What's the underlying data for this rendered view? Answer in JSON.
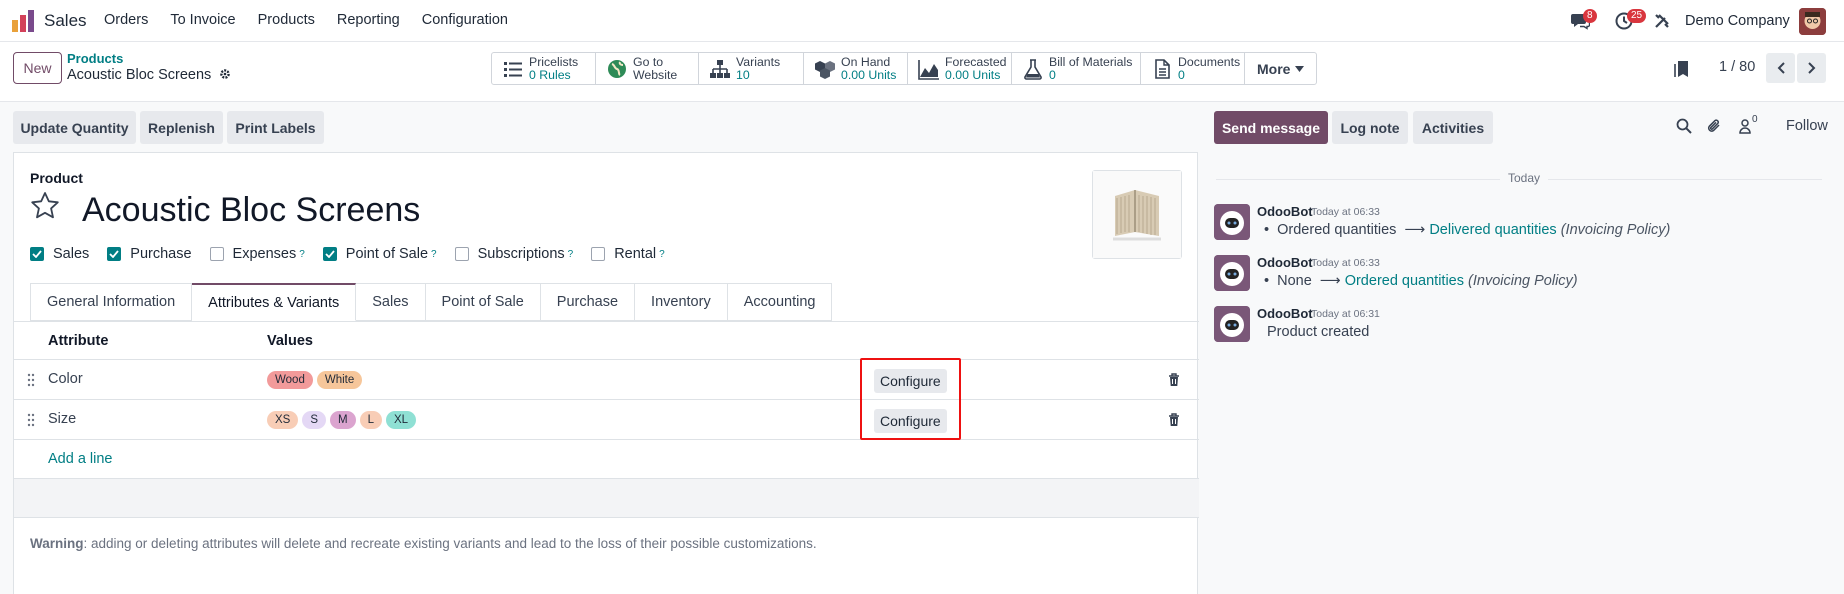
{
  "navbar": {
    "app_name": "Sales",
    "menu": [
      "Orders",
      "To Invoice",
      "Products",
      "Reporting",
      "Configuration"
    ],
    "messages_count": "8",
    "activities_count": "25",
    "company": "Demo Company"
  },
  "control_panel": {
    "new_label": "New",
    "breadcrumb_parent": "Products",
    "breadcrumb_current": "Acoustic Bloc Screens",
    "smart_buttons": [
      {
        "label": "Pricelists",
        "value": "0 Rules",
        "icon": "list-icon"
      },
      {
        "label": "Go to",
        "value": "Website",
        "icon": "globe-icon"
      },
      {
        "label": "Variants",
        "value": "10",
        "icon": "sitemap-icon"
      },
      {
        "label": "On Hand",
        "value": "0.00 Units",
        "icon": "cubes-icon"
      },
      {
        "label": "Forecasted",
        "value": "0.00 Units",
        "icon": "area-chart-icon"
      },
      {
        "label": "Bill of Materials",
        "value": "0",
        "icon": "flask-icon"
      },
      {
        "label": "Documents",
        "value": "0",
        "icon": "file-icon"
      }
    ],
    "more_label": "More",
    "pager": "1 / 80"
  },
  "actions": {
    "update_quantity": "Update Quantity",
    "replenish": "Replenish",
    "print_labels": "Print Labels"
  },
  "form": {
    "product_label": "Product",
    "product_name": "Acoustic Bloc Screens",
    "checkboxes": [
      {
        "label": "Sales",
        "checked": true,
        "help": ""
      },
      {
        "label": "Purchase",
        "checked": true,
        "help": ""
      },
      {
        "label": "Expenses",
        "checked": false,
        "help": "?"
      },
      {
        "label": "Point of Sale",
        "checked": true,
        "help": "?"
      },
      {
        "label": "Subscriptions",
        "checked": false,
        "help": "?"
      },
      {
        "label": "Rental",
        "checked": false,
        "help": "?"
      }
    ],
    "tabs": [
      "General Information",
      "Attributes & Variants",
      "Sales",
      "Point of Sale",
      "Purchase",
      "Inventory",
      "Accounting"
    ],
    "active_tab": "Attributes & Variants",
    "table": {
      "headers": [
        "Attribute",
        "Values"
      ],
      "rows": [
        {
          "attribute": "Color",
          "values": [
            {
              "name": "Wood",
              "color": "#f29a9a"
            },
            {
              "name": "White",
              "color": "#f6c69a"
            }
          ],
          "configure": "Configure"
        },
        {
          "attribute": "Size",
          "values": [
            {
              "name": "XS",
              "color": "#f8cdb6"
            },
            {
              "name": "S",
              "color": "#e4d8f5"
            },
            {
              "name": "M",
              "color": "#dba4cf"
            },
            {
              "name": "L",
              "color": "#f8cdb6"
            },
            {
              "name": "XL",
              "color": "#8fe0d4"
            }
          ],
          "configure": "Configure"
        }
      ],
      "add_line": "Add a line"
    },
    "warning_label": "Warning",
    "warning_text": ": adding or deleting attributes will delete and recreate existing variants and lead to the loss of their possible customizations."
  },
  "chatter": {
    "send_message": "Send message",
    "log_note": "Log note",
    "activities": "Activities",
    "followers_count": "0",
    "follow": "Follow",
    "today": "Today",
    "messages": [
      {
        "author": "OdooBot",
        "time": "Today at 06:33",
        "old": "Ordered quantities",
        "new": "Delivered quantities",
        "field": "(Invoicing Policy)"
      },
      {
        "author": "OdooBot",
        "time": "Today at 06:33",
        "old": "None",
        "new": "Ordered quantities",
        "field": "(Invoicing Policy)"
      },
      {
        "author": "OdooBot",
        "time": "Today at 06:31",
        "text": "Product created"
      }
    ]
  },
  "colors": {
    "primary": "#714b67",
    "link": "#017e84",
    "highlight": "#ee1111"
  }
}
